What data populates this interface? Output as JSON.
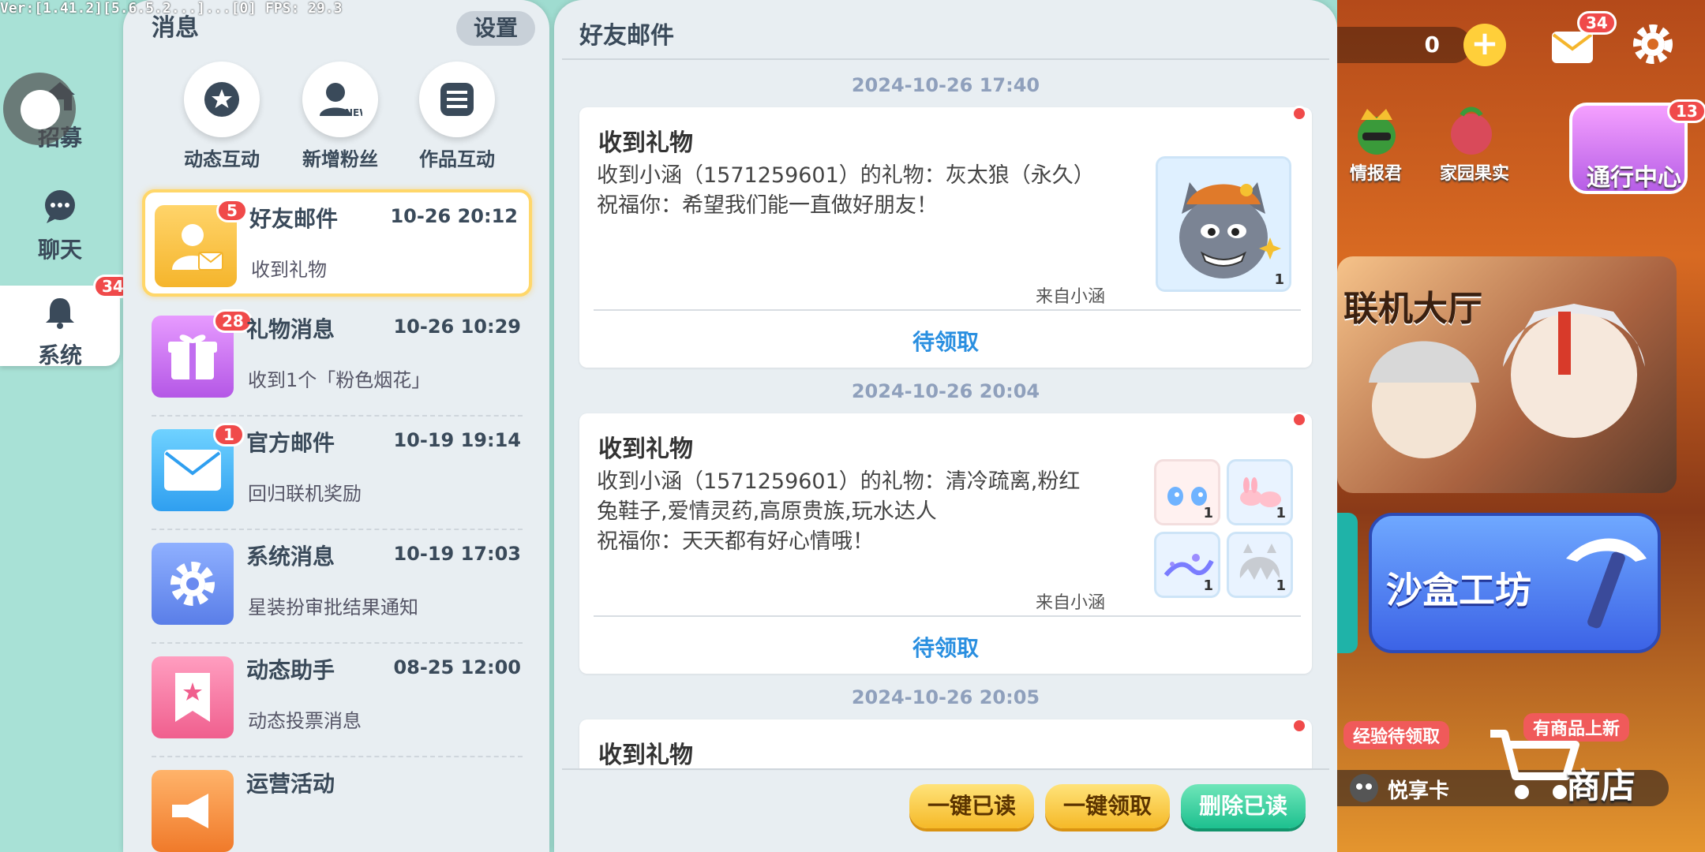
{
  "debug_text": "Ver:[1.41.2][5.6.5.2...]...[0] FPS: 29.3",
  "rail": {
    "recruit": "招募",
    "chat": "聊天",
    "system": "系统",
    "system_badge": "34"
  },
  "list": {
    "title": "消息",
    "settings": "设置",
    "quick": [
      "动态互动",
      "新增粉丝",
      "作品互动"
    ],
    "items": [
      {
        "title": "好友邮件",
        "time": "10-26 20:12",
        "sub": "收到礼物",
        "badge": "5"
      },
      {
        "title": "礼物消息",
        "time": "10-26 10:29",
        "sub": "收到1个「粉色烟花」",
        "badge": "28"
      },
      {
        "title": "官方邮件",
        "time": "10-19 19:14",
        "sub": "回归联机奖励",
        "badge": "1"
      },
      {
        "title": "系统消息",
        "time": "10-19 17:03",
        "sub": "星装扮审批结果通知"
      },
      {
        "title": "动态助手",
        "time": "08-25 12:00",
        "sub": "动态投票消息"
      },
      {
        "title": "运营活动"
      }
    ]
  },
  "detail": {
    "title": "好友邮件",
    "mails": [
      {
        "stamp": "2024-10-26 17:40",
        "title": "收到礼物",
        "body_1": "收到小涵（1571259601）的礼物：灰太狼（永久）",
        "body_2": "祝福你：希望我们能一直做好朋友！",
        "from": "来自小涵",
        "claim": "待领取",
        "gift_count": "1"
      },
      {
        "stamp": "2024-10-26 20:04",
        "title": "收到礼物",
        "body_1": "收到小涵（1571259601）的礼物：清冷疏离,粉红",
        "body_2": "兔鞋子,爱情灵药,高原贵族,玩水达人",
        "body_3": "祝福你：天天都有好心情哦！",
        "from": "来自小涵",
        "claim": "待领取",
        "gift_counts": [
          "1",
          "1",
          "1",
          "1"
        ]
      },
      {
        "stamp": "2024-10-26 20:05",
        "title": "收到礼物"
      }
    ],
    "buttons": {
      "read_all": "一键已读",
      "claim_all": "一键领取",
      "delete_read": "删除已读"
    }
  },
  "game": {
    "coins": "0",
    "mail_badge": "34",
    "intel": "情报君",
    "garden": "家园果实",
    "pass_center": "通行中心",
    "pass_badge": "13",
    "hall": "联机大厅",
    "sandbox": "沙盒工坊",
    "exp_ribbon": "经验待领取",
    "new_goods_ribbon": "有商品上新",
    "vip_card": "悦享卡",
    "shop": "商店"
  },
  "colors": {
    "accent_claim": "#2a8fe0",
    "badge_red": "#f04a4a",
    "active_border": "#ffd76a"
  }
}
